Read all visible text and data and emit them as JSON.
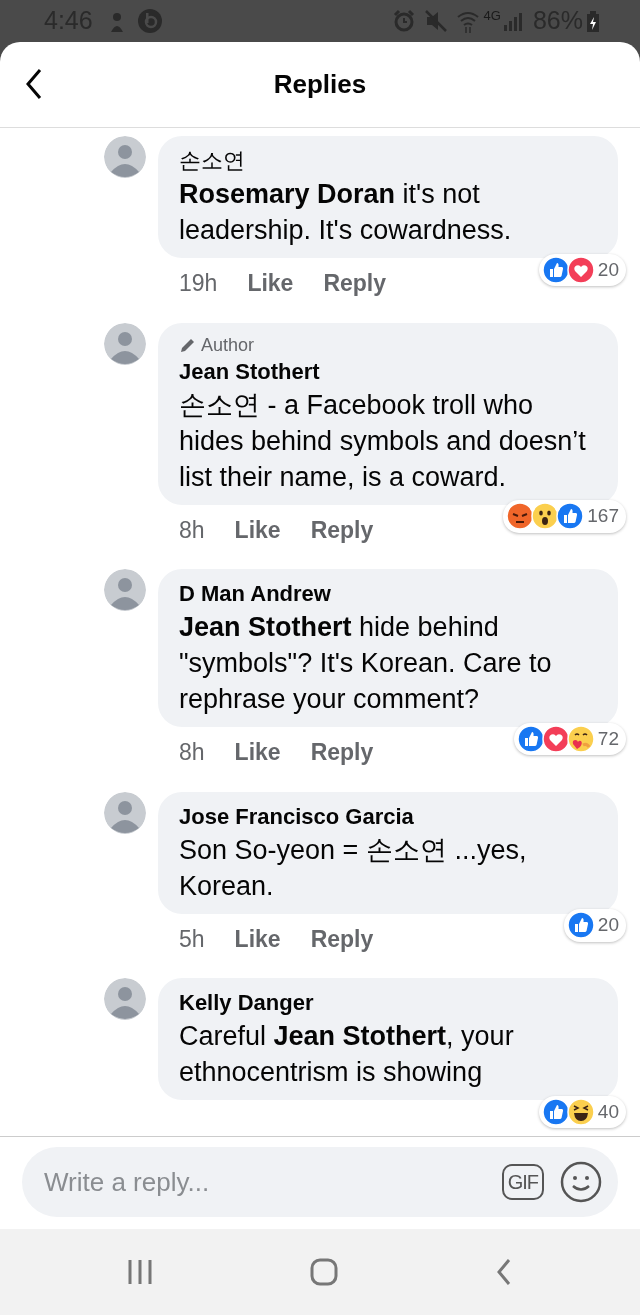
{
  "status_bar": {
    "time": "4:46",
    "network": "4G",
    "battery": "86%"
  },
  "header": {
    "title": "Replies"
  },
  "comments": [
    {
      "author": "손소연",
      "author_bold": false,
      "body": "**Rosemary Doran** it's not leadership. It's cowardness.",
      "time": "19h",
      "like": "Like",
      "reply": "Reply",
      "reactions": [
        {
          "kind": "like"
        },
        {
          "kind": "love"
        }
      ],
      "reaction_count": "20"
    },
    {
      "author": "Jean Stothert",
      "author_bold": true,
      "badge": "Author",
      "body": "손소연 - a Facebook troll who hides behind symbols and doesn’t list their name, is a coward.",
      "time": "8h",
      "like": "Like",
      "reply": "Reply",
      "reactions": [
        {
          "kind": "angry"
        },
        {
          "kind": "wow"
        },
        {
          "kind": "like"
        }
      ],
      "reaction_count": "167"
    },
    {
      "author": "D Man Andrew",
      "author_bold": true,
      "body": "**Jean Stothert** hide behind \"symbols\"?  It's Korean.  Care to rephrase your comment?",
      "time": "8h",
      "like": "Like",
      "reply": "Reply",
      "reactions": [
        {
          "kind": "like"
        },
        {
          "kind": "love"
        },
        {
          "kind": "care"
        }
      ],
      "reaction_count": "72"
    },
    {
      "author": "Jose Francisco Garcia",
      "author_bold": true,
      "body": "Son So-yeon =  손소연 ...yes, Korean.",
      "time": "5h",
      "like": "Like",
      "reply": "Reply",
      "reactions": [
        {
          "kind": "like"
        }
      ],
      "reaction_count": "20"
    },
    {
      "author": "Kelly Danger",
      "author_bold": true,
      "body": "Careful **Jean Stothert**, your ethnocentrism is showing",
      "reactions": [
        {
          "kind": "like"
        },
        {
          "kind": "haha"
        }
      ],
      "reaction_count": "40"
    }
  ],
  "composer": {
    "placeholder": "Write a reply...",
    "gif": "GIF"
  }
}
